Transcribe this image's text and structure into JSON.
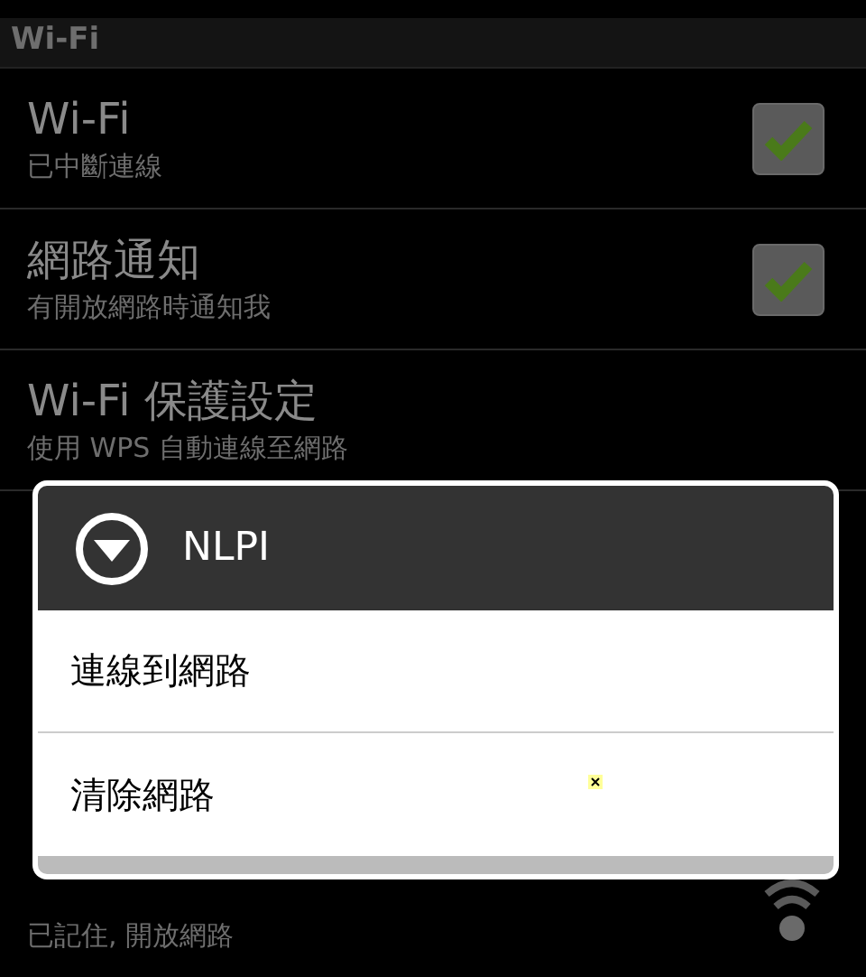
{
  "section_header": "Wi-Fi",
  "settings": [
    {
      "kind": "checkbox",
      "title": "Wi-Fi",
      "summary": "已中斷連線",
      "checked": true
    },
    {
      "kind": "checkbox",
      "title": "網路通知",
      "summary": "有開放網路時通知我",
      "checked": true
    },
    {
      "kind": "plain",
      "title": "Wi-Fi 保護設定",
      "summary": "使用 WPS 自動連線至網路"
    }
  ],
  "networks": [
    {
      "kind": "wifi",
      "summary": "已記住, 開放網路"
    }
  ],
  "dialog": {
    "title": "NLPI",
    "items": [
      "連線到網路",
      "清除網路"
    ]
  }
}
